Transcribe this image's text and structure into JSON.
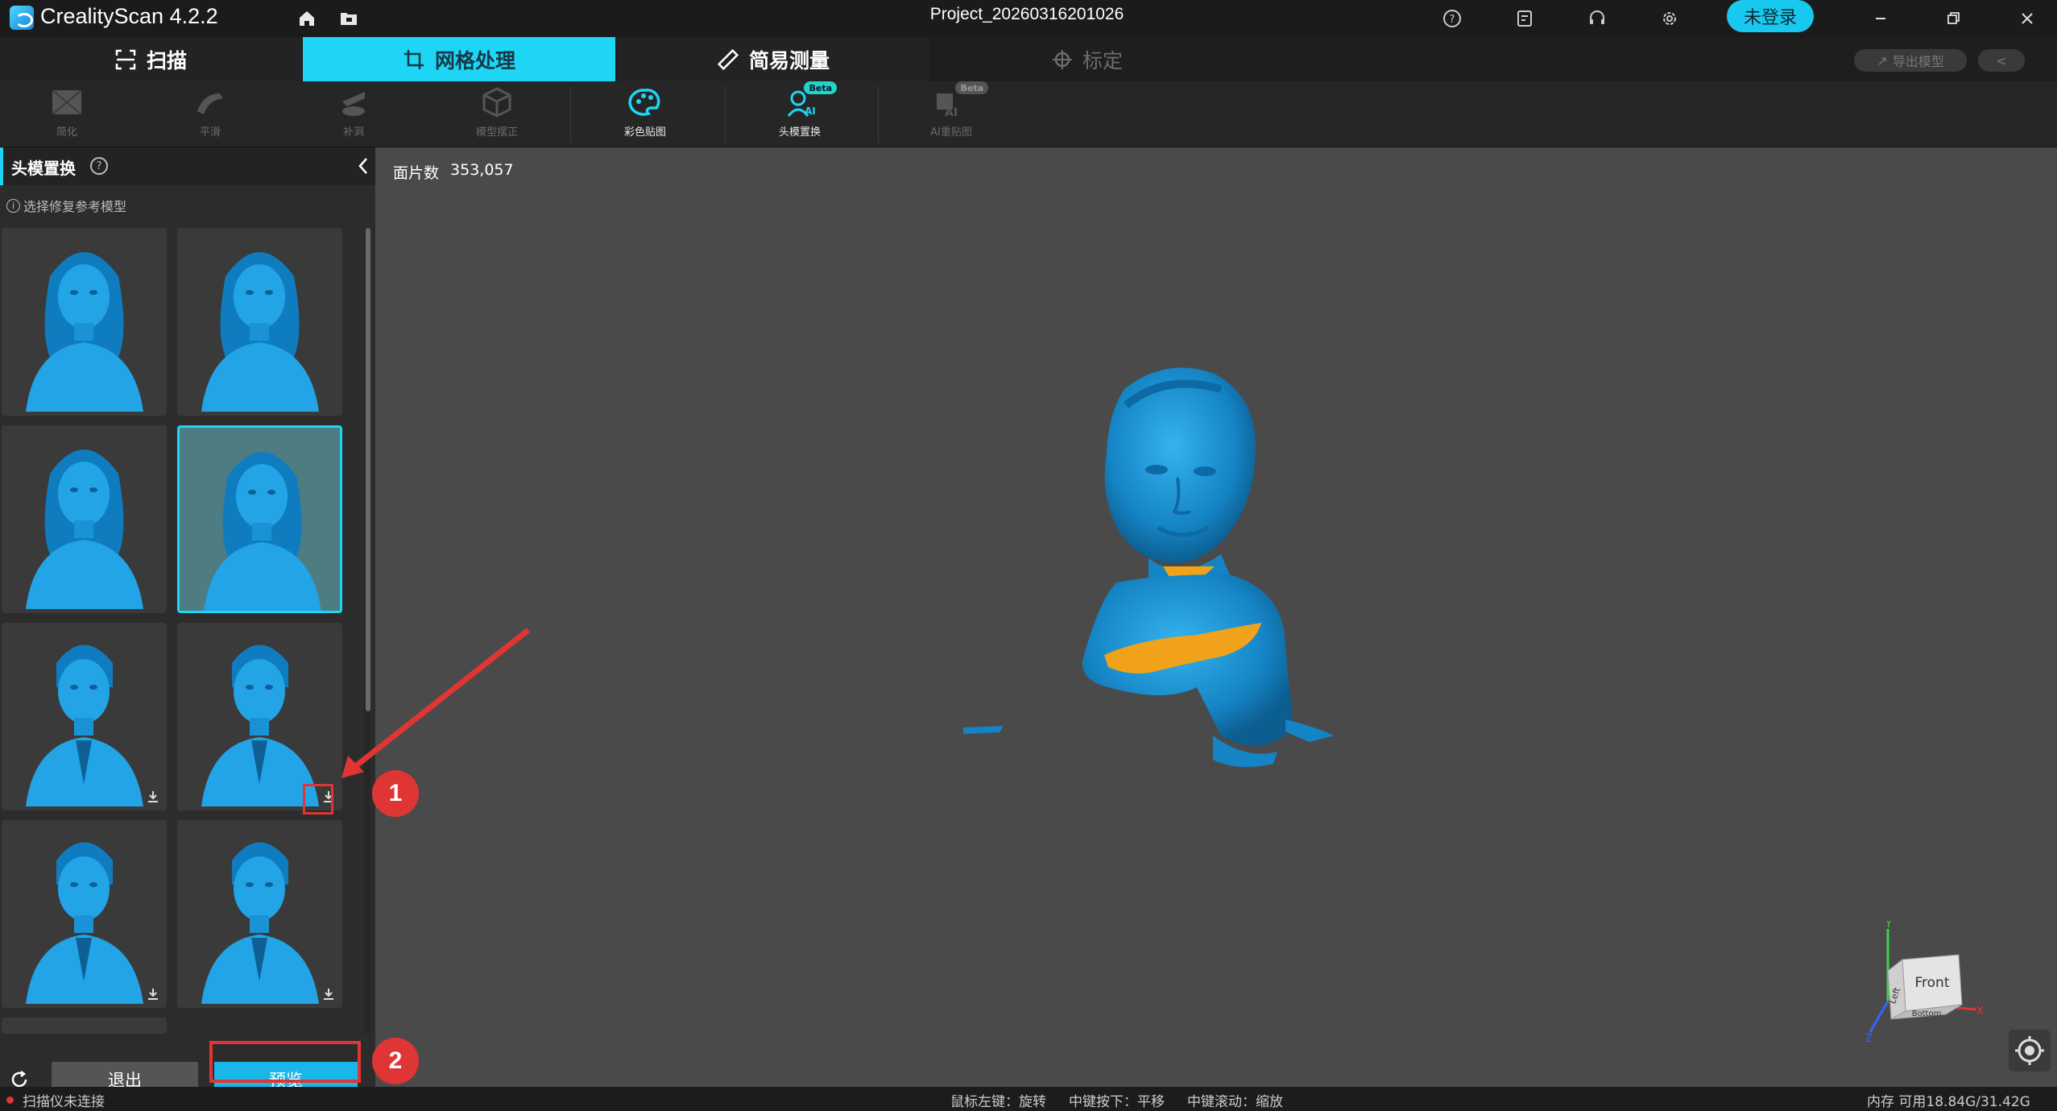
{
  "titlebar": {
    "app_name": "CrealityScan 4.2.2",
    "project_title": "Project_20260316201026",
    "login_label": "未登录",
    "icons": [
      "home-icon",
      "folder-icon",
      "help-icon",
      "notes-icon",
      "support-icon",
      "settings-icon",
      "minimize-icon",
      "restore-icon",
      "close-icon"
    ]
  },
  "maintabs": {
    "scan": "扫描",
    "mesh": "网格处理",
    "measure": "简易测量",
    "calibrate": "标定",
    "export": "导出模型"
  },
  "toolbar": {
    "tools": [
      {
        "label": "简化",
        "enabled": false
      },
      {
        "label": "平滑",
        "enabled": false
      },
      {
        "label": "补洞",
        "enabled": false
      },
      {
        "label": "模型摆正",
        "enabled": false
      },
      {
        "label": "彩色贴图",
        "enabled": true
      },
      {
        "label": "头模置换",
        "enabled": true,
        "badge": "Beta"
      },
      {
        "label": "AI重贴图",
        "enabled": false,
        "badge": "Beta"
      }
    ]
  },
  "panel": {
    "title": "头模置换",
    "hint": "选择修复参考模型",
    "exit_label": "退出",
    "preview_label": "预览",
    "selected_index": 3,
    "models": [
      {
        "kind": "female-long-hair",
        "downloaded": true
      },
      {
        "kind": "female-bob",
        "downloaded": true
      },
      {
        "kind": "female-bun",
        "downloaded": true
      },
      {
        "kind": "female-pigtails",
        "downloaded": true
      },
      {
        "kind": "male-short",
        "downloaded": false
      },
      {
        "kind": "male-suit",
        "downloaded": false
      },
      {
        "kind": "male-wavy",
        "downloaded": false
      },
      {
        "kind": "male-curly",
        "downloaded": false
      }
    ]
  },
  "viewport": {
    "face_count_label": "面片数",
    "face_count_value": "353,057",
    "view_cube": {
      "front": "Front",
      "left": "Left",
      "bottom": "Bottom",
      "x": "X",
      "y": "Y",
      "z": "Z"
    }
  },
  "annotations": {
    "step1": "1",
    "step2": "2"
  },
  "statusbar": {
    "scanner_status": "扫描仪未连接",
    "hint_rotate": "鼠标左键：旋转",
    "hint_pan": "中键按下：平移",
    "hint_zoom": "中键滚动：缩放",
    "memory": "内存 可用18.84G/31.42G"
  },
  "colors": {
    "accent": "#1ed5f5",
    "model_blue": "#1a8fd0",
    "patch_orange": "#f0a31a",
    "annotation_red": "#e03535"
  }
}
